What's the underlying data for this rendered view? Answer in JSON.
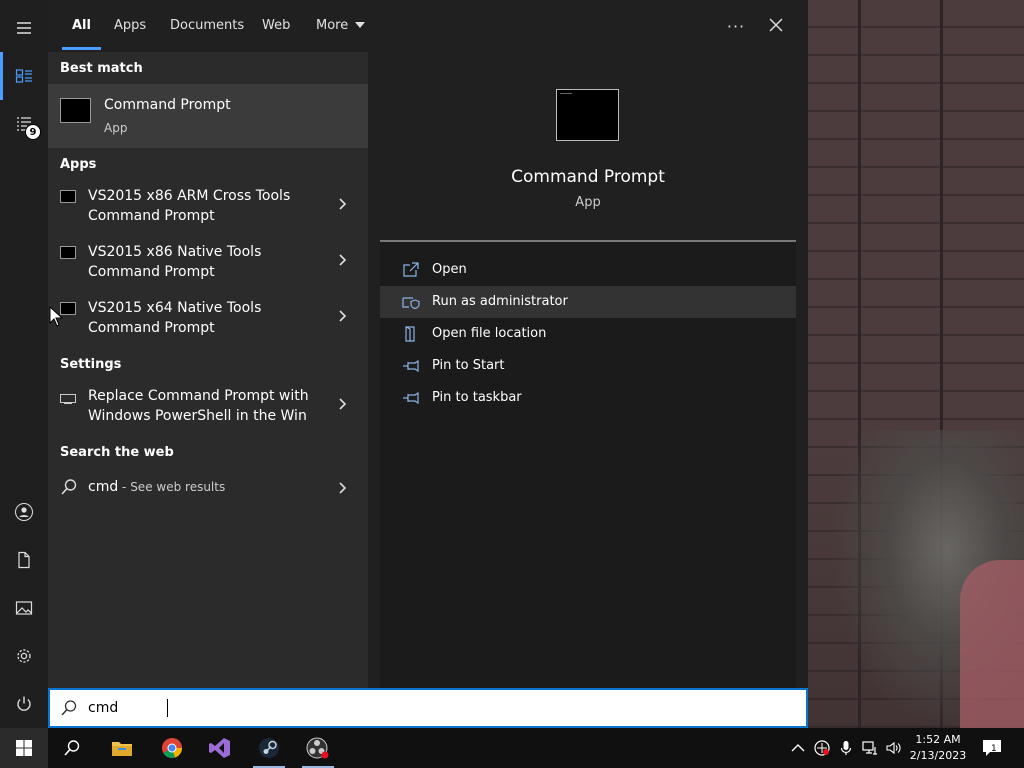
{
  "tabs": {
    "all": "All",
    "apps": "Apps",
    "documents": "Documents",
    "web": "Web",
    "more": "More"
  },
  "rail": {
    "badge_count": "9"
  },
  "results": {
    "best_match_header": "Best match",
    "best_match": {
      "title": "Command Prompt",
      "subtitle": "App"
    },
    "apps_header": "Apps",
    "apps": [
      {
        "line1": "VS2015 x86 ARM Cross Tools",
        "line2": "Command Prompt"
      },
      {
        "line1": "VS2015 x86 Native Tools",
        "line2": "Command Prompt"
      },
      {
        "line1": "VS2015 x64 Native Tools",
        "line2": "Command Prompt"
      }
    ],
    "settings_header": "Settings",
    "settings": [
      {
        "line1": "Replace Command Prompt with",
        "line2": "Windows PowerShell in the Win"
      }
    ],
    "web_header": "Search the web",
    "web": {
      "query": "cmd",
      "suffix": " - See web results"
    }
  },
  "preview": {
    "title": "Command Prompt",
    "subtitle": "App",
    "actions": [
      {
        "label": "Open",
        "icon": "open-icon"
      },
      {
        "label": "Run as administrator",
        "icon": "shield-icon"
      },
      {
        "label": "Open file location",
        "icon": "file-location-icon"
      },
      {
        "label": "Pin to Start",
        "icon": "pin-icon"
      },
      {
        "label": "Pin to taskbar",
        "icon": "pin-icon"
      }
    ]
  },
  "search": {
    "value": "cmd"
  },
  "taskbar": {
    "time": "1:52 AM",
    "date": "2/13/2023",
    "notification_count": "1"
  },
  "colors": {
    "accent": "#4a9eff",
    "search_border": "#0a74d2"
  }
}
